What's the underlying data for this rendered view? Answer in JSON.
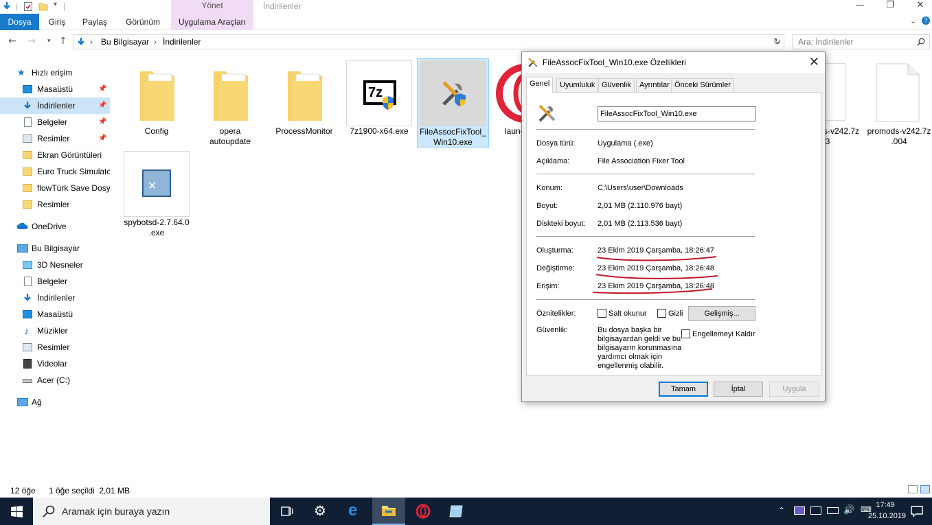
{
  "window": {
    "title": "İndirilenler",
    "contextual_tab_group": "Yönet",
    "controls": {
      "minimize": "—",
      "maximize": "❐",
      "close": "✕"
    }
  },
  "ribbon": {
    "tabs": [
      "Dosya",
      "Giriş",
      "Paylaş",
      "Görünüm",
      "Uygulama Araçları"
    ],
    "expand_icon": "chevron-down-icon",
    "help_icon": "help-icon"
  },
  "address": {
    "breadcrumbs": [
      "Bu Bilgisayar",
      "İndirilenler"
    ],
    "separator": "›",
    "search_placeholder": "Ara: İndirilenler"
  },
  "nav_pane": {
    "quick_access": "Hızlı erişim",
    "quick_items": [
      {
        "label": "Masaüstü",
        "icon": "desktop-icon",
        "pinned": true
      },
      {
        "label": "İndirilenler",
        "icon": "download-icon",
        "pinned": true,
        "selected": true
      },
      {
        "label": "Belgeler",
        "icon": "documents-icon",
        "pinned": true
      },
      {
        "label": "Resimler",
        "icon": "pictures-icon",
        "pinned": true
      },
      {
        "label": "Ekran Görüntüleri",
        "icon": "folder-icon"
      },
      {
        "label": "Euro Truck Simulatc",
        "icon": "folder-icon"
      },
      {
        "label": "flowTürk Save Dosy",
        "icon": "folder-icon"
      },
      {
        "label": "Resimler",
        "icon": "folder-icon"
      }
    ],
    "onedrive": "OneDrive",
    "this_pc": "Bu Bilgisayar",
    "pc_items": [
      {
        "label": "3D Nesneler",
        "icon": "3d-objects-icon"
      },
      {
        "label": "Belgeler",
        "icon": "documents-icon"
      },
      {
        "label": "İndirilenler",
        "icon": "download-icon"
      },
      {
        "label": "Masaüstü",
        "icon": "desktop-icon"
      },
      {
        "label": "Müzikler",
        "icon": "music-icon"
      },
      {
        "label": "Resimler",
        "icon": "pictures-icon"
      },
      {
        "label": "Videolar",
        "icon": "videos-icon"
      },
      {
        "label": "Acer (C:)",
        "icon": "drive-icon"
      }
    ],
    "network": "Ağ"
  },
  "files": [
    {
      "name_lines": [
        "Config"
      ],
      "type": "folder"
    },
    {
      "name_lines": [
        "opera",
        "autoupdate"
      ],
      "type": "folder"
    },
    {
      "name_lines": [
        "ProcessMonitor"
      ],
      "type": "folder"
    },
    {
      "name_lines": [
        "7z1900-x64.exe"
      ],
      "type": "exe-7zip"
    },
    {
      "name_lines": [
        "FileAssocFixTool_",
        "Win10.exe"
      ],
      "type": "exe-tool",
      "selected": true
    },
    {
      "name_lines": [
        "launc"
      ],
      "type": "exe-opera"
    },
    {
      "name_lines": [
        "s-v242.7z",
        "03"
      ],
      "type": "file"
    },
    {
      "name_lines": [
        "promods-v242.7z",
        ".004"
      ],
      "type": "file"
    },
    {
      "name_lines": [
        "spybotsd-2.7.64.0",
        ".exe"
      ],
      "type": "exe-spybot"
    }
  ],
  "status": {
    "item_count": "12 öğe",
    "selection": "1 öğe seçildi  2,01 MB"
  },
  "dialog": {
    "title": "FileAssocFixTool_Win10.exe Özellikleri",
    "tabs": [
      "Genel",
      "Uyumluluk",
      "Güvenlik",
      "Ayrıntılar",
      "Önceki Sürümler"
    ],
    "filename": "FileAssocFixTool_Win10.exe",
    "rows1": [
      {
        "label": "Dosya türü:",
        "value": "Uygulama (.exe)"
      },
      {
        "label": "Açıklama:",
        "value": "File Association Fixer Tool"
      }
    ],
    "rows2": [
      {
        "label": "Konum:",
        "value": "C:\\Users\\user\\Downloads"
      },
      {
        "label": "Boyut:",
        "value": "2,01 MB (2.110.976 bayt)"
      },
      {
        "label": "Diskteki boyut:",
        "value": "2,01 MB (2.113.536 bayt)"
      }
    ],
    "rows3": [
      {
        "label": "Oluşturma:",
        "value": "23 Ekim 2019 Çarşamba, 18:26:47"
      },
      {
        "label": "Değiştirme:",
        "value": "23 Ekim 2019 Çarşamba, 18:26:48"
      },
      {
        "label": "Erişim:",
        "value": "23 Ekim 2019 Çarşamba, 18:26:48"
      }
    ],
    "attributes_label": "Öznitelikler:",
    "readonly_label": "Salt okunur",
    "hidden_label": "Gizli",
    "advanced_button": "Gelişmiş...",
    "security_label": "Güvenlik:",
    "security_text": [
      "Bu dosya başka bir",
      "bilgisayardan geldi ve bu",
      "bilgisayarın korunmasına",
      "yardımcı olmak için",
      "engellenmiş olabilir."
    ],
    "unblock_label": "Engellemeyi Kaldır",
    "buttons": {
      "ok": "Tamam",
      "cancel": "İptal",
      "apply": "Uygula"
    },
    "annotation_color": "#c0162a"
  },
  "taskbar": {
    "search_placeholder": "Aramak için buraya yazın",
    "time": "17:49",
    "date": "25.10.2019",
    "accent": "#76b9ed"
  }
}
